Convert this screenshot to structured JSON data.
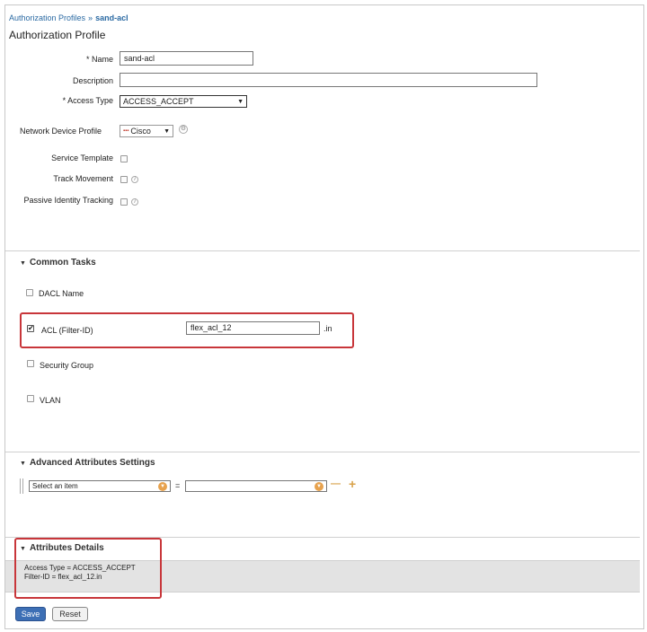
{
  "breadcrumb": {
    "parent": "Authorization Profiles",
    "separator": "»",
    "current": "sand-acl"
  },
  "page_title": "Authorization Profile",
  "form": {
    "name_label": "* Name",
    "name_value": "sand-acl",
    "description_label": "Description",
    "description_value": "",
    "access_type_label": "* Access Type",
    "access_type_value": "ACCESS_ACCEPT",
    "ndp_label": "Network Device Profile",
    "ndp_value": "Cisco",
    "service_template_label": "Service Template",
    "track_movement_label": "Track Movement",
    "passive_identity_label": "Passive Identity Tracking"
  },
  "common_tasks": {
    "title": "Common Tasks",
    "dacl_label": "DACL Name",
    "acl_label": "ACL  (Filter-ID)",
    "acl_value": "flex_acl_12",
    "acl_suffix": ".in",
    "security_group_label": "Security Group",
    "vlan_label": "VLAN"
  },
  "advanced": {
    "title": "Advanced Attributes Settings",
    "select_placeholder": "Select an item",
    "equals": "=",
    "remove_symbol": "—",
    "add_symbol": "+"
  },
  "details": {
    "title": "Attributes Details",
    "line1": "Access Type = ACCESS_ACCEPT",
    "line2": "Filter-ID = flex_acl_12.in"
  },
  "buttons": {
    "save": "Save",
    "reset": "Reset"
  },
  "colors": {
    "highlight_border": "#c8363a",
    "link": "#2b6aa3",
    "save_button": "#3d6fb5"
  }
}
